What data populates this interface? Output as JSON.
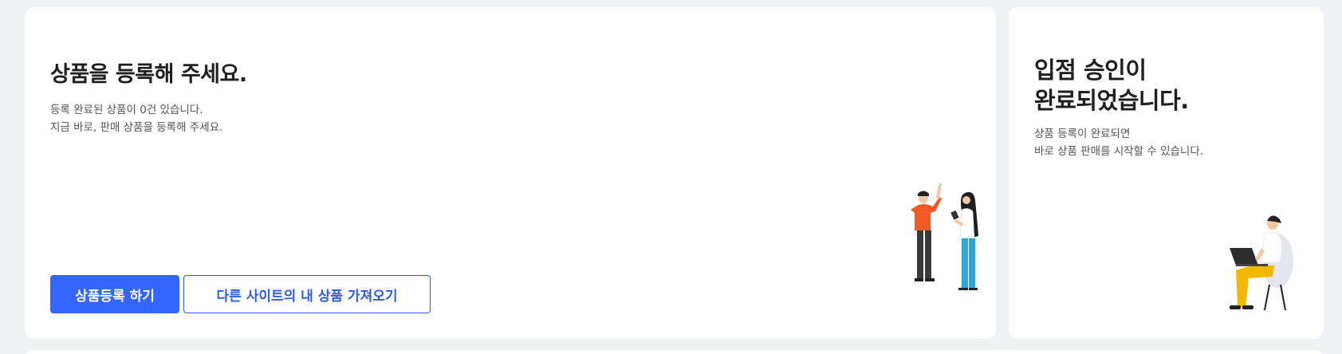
{
  "main_card": {
    "title": "상품을 등록해 주세요.",
    "description_line1": "등록 완료된 상품이 0건 있습니다.",
    "description_line2": "지금 바로, 판매 상품을 등록해 주세요.",
    "primary_button": "상품등록 하기",
    "secondary_button": "다른 사이트의 내 상품 가져오기"
  },
  "side_card": {
    "title_line1": "입점 승인이",
    "title_line2": "완료되었습니다.",
    "description_line1": "상품 등록이 완료되면",
    "description_line2": "바로 상품 판매를 시작할 수 있습니다."
  },
  "colors": {
    "primary": "#3366ff",
    "secondary_border": "#2d5bec",
    "background": "#f0f1f5"
  },
  "icons": {
    "main_illustration": "high-five-people-illustration",
    "side_illustration": "person-with-laptop-illustration"
  }
}
